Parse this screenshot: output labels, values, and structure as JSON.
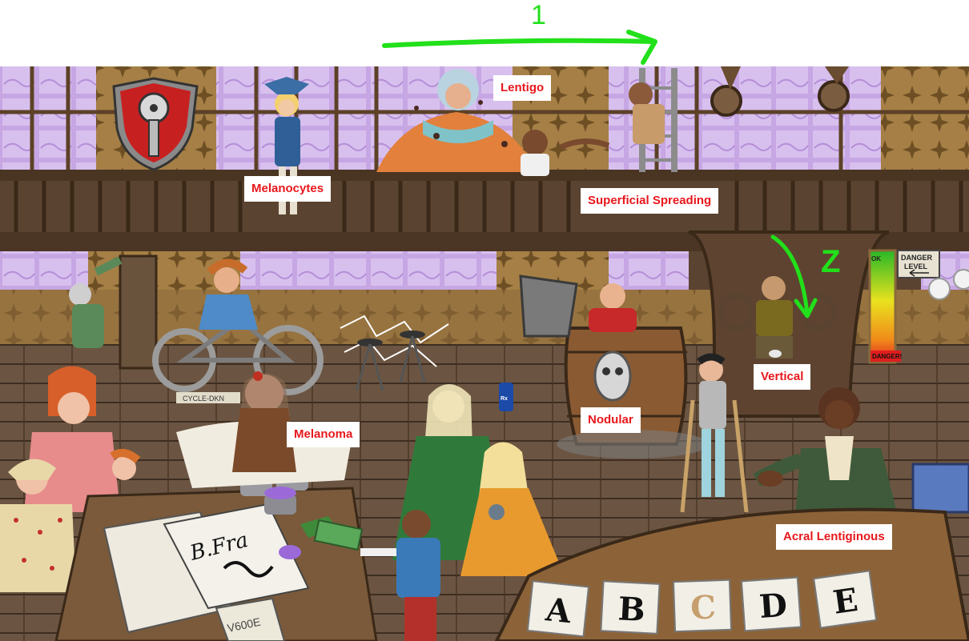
{
  "labels": {
    "lentigo": "Lentigo",
    "melanocytes": "Melanocytes",
    "superficial_spreading": "Superficial Spreading",
    "melanoma": "Melanoma",
    "nodular": "Nodular",
    "vertical": "Vertical",
    "acral_lentiginous": "Acral Lentiginous"
  },
  "annotations": {
    "marker_digit": "1",
    "marker_letter": "Z"
  },
  "danger_meter": {
    "ok_label": "OK",
    "title_line1": "DANGER",
    "title_line2": "LEVEL",
    "danger_label": "DANGER!"
  },
  "scene_text": {
    "bicycle_sign": "CYCLE-DKN",
    "signature": "B.Fra",
    "paper_code": "V600E",
    "bottle_label": "Rx"
  },
  "cards": [
    "A",
    "B",
    "C",
    "D",
    "E"
  ],
  "colors": {
    "label_text": "#e8171c",
    "label_bg": "#ffffff",
    "annotation_green": "#22e01a",
    "window_purple": "#c9a8e6",
    "wood_dark": "#4b3524"
  }
}
